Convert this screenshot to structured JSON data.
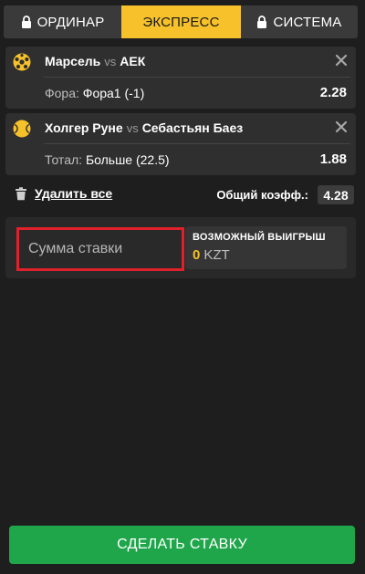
{
  "tabs": [
    {
      "label": "ОРДИНАР",
      "icon": "lock-icon",
      "active": false
    },
    {
      "label": "ЭКСПРЕСС",
      "active": true
    },
    {
      "label": "СИСТЕМА",
      "icon": "lock-icon",
      "active": false
    }
  ],
  "bets": [
    {
      "sport_icon": "football-icon",
      "home": "Марсель",
      "vs": "vs",
      "away": "АЕК",
      "market_label": "Фора:",
      "selection": "Фора1 (-1)",
      "odds": "2.28"
    },
    {
      "sport_icon": "tennis-ball-icon",
      "home": "Холгер Руне",
      "vs": "vs",
      "away": "Себастьян Баез",
      "market_label": "Тотал:",
      "selection": "Больше (22.5)",
      "odds": "1.88"
    }
  ],
  "actions": {
    "delete_all": "Удалить все",
    "total_coef_label": "Общий коэфф.:",
    "total_coef": "4.28"
  },
  "stake": {
    "placeholder": "Сумма ставки",
    "value": ""
  },
  "possible_win": {
    "label": "ВОЗМОЖНЫЙ ВЫИГРЫШ",
    "amount": "0",
    "currency": "KZT"
  },
  "place_bet_label": "СДЕЛАТЬ СТАВКУ",
  "colors": {
    "accent": "#f6c12b",
    "highlight_border": "#e0202a",
    "button_green": "#1fa64a",
    "background": "#1e1e1e"
  }
}
